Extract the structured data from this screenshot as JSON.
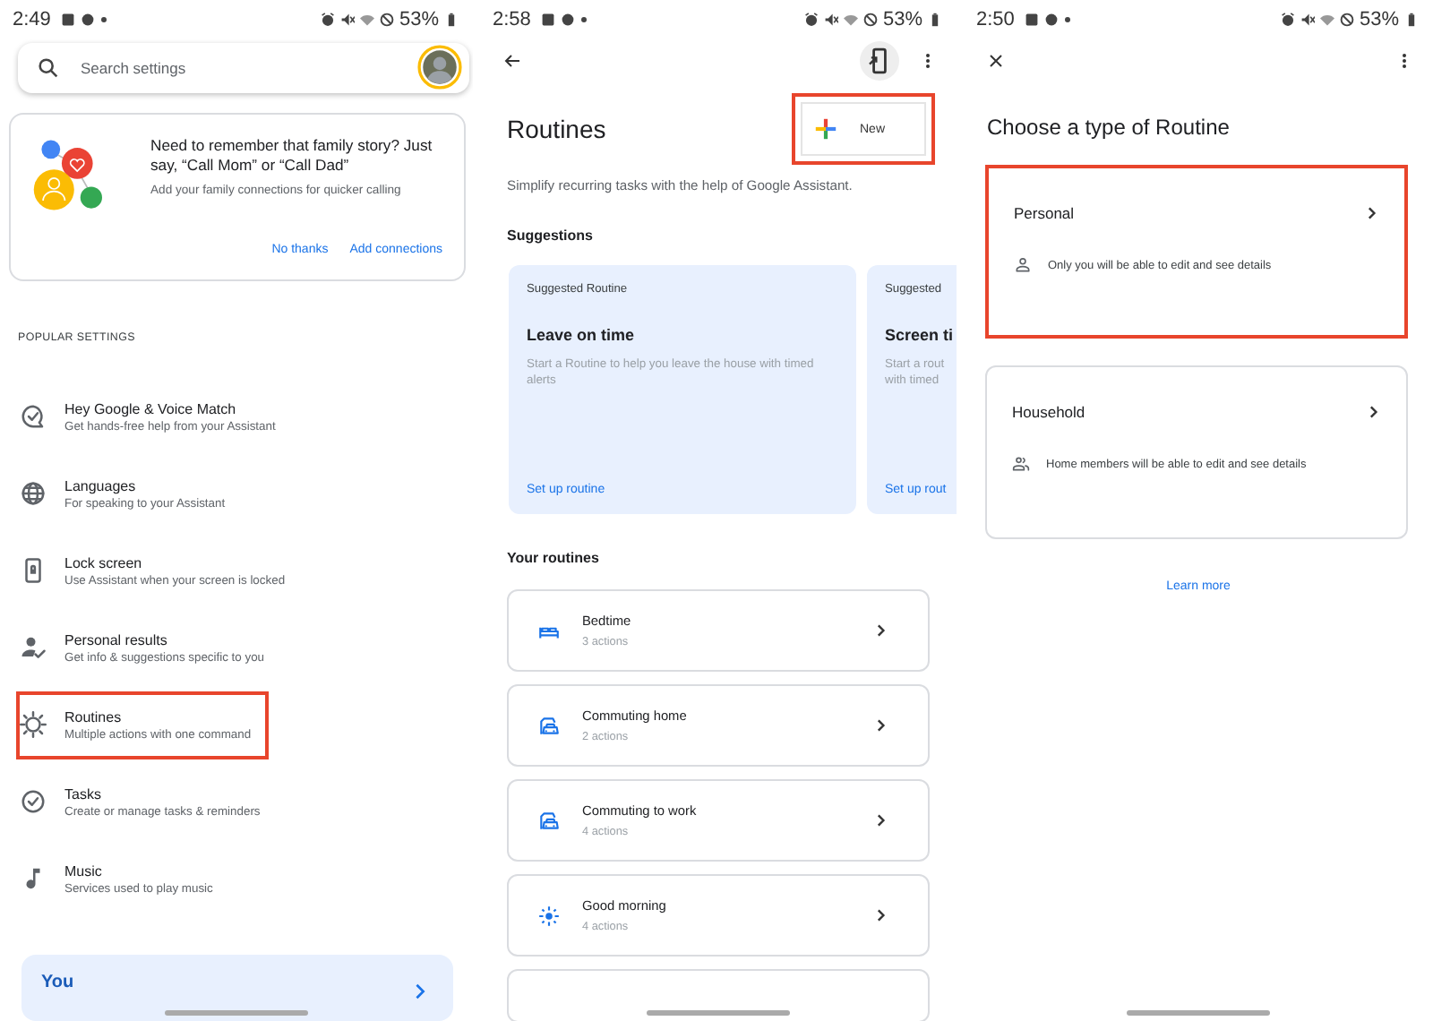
{
  "screens": [
    {
      "kind": "settings",
      "time": "2:49",
      "battery": "53%",
      "search": {
        "placeholder": "Search settings"
      },
      "promo": {
        "title": "Need to remember that family story? Just say, “Call Mom” or “Call Dad”",
        "subtitle": "Add your family connections for quicker calling",
        "actions": [
          "No thanks",
          "Add connections"
        ]
      },
      "section": "POPULAR SETTINGS",
      "items": [
        {
          "title": "Hey Google & Voice Match",
          "subtitle": "Get hands-free help from your Assistant",
          "highlighted": false
        },
        {
          "title": "Languages",
          "subtitle": "For speaking to your Assistant",
          "highlighted": false
        },
        {
          "title": "Lock screen",
          "subtitle": "Use Assistant when your screen is locked",
          "highlighted": false
        },
        {
          "title": "Personal results",
          "subtitle": "Get info & suggestions specific to you",
          "highlighted": false
        },
        {
          "title": "Routines",
          "subtitle": "Multiple actions with one command",
          "highlighted": true
        },
        {
          "title": "Tasks",
          "subtitle": "Create or manage tasks & reminders",
          "highlighted": false
        },
        {
          "title": "Music",
          "subtitle": "Services used to play music",
          "highlighted": false
        }
      ],
      "you_card": {
        "title": "You"
      }
    },
    {
      "kind": "routines",
      "time": "2:58",
      "battery": "53%",
      "title": "Routines",
      "new_button": {
        "label": "New",
        "highlighted": true
      },
      "description": "Simplify recurring tasks with the help of Google Assistant.",
      "suggestions_heading": "Suggestions",
      "suggestions": [
        {
          "tag": "Suggested Routine",
          "title": "Leave on time",
          "text": "Start a Routine to help you leave the house with timed alerts",
          "action": "Set up routine"
        },
        {
          "tag": "Suggested",
          "title": "Screen ti",
          "text": "Start a rout\nwith timed",
          "action": "Set up rout"
        }
      ],
      "routines_heading": "Your routines",
      "routines": [
        {
          "title": "Bedtime",
          "subtitle": "3 actions"
        },
        {
          "title": "Commuting home",
          "subtitle": "2 actions"
        },
        {
          "title": "Commuting to work",
          "subtitle": "4 actions"
        },
        {
          "title": "Good morning",
          "subtitle": "4 actions"
        }
      ]
    },
    {
      "kind": "type",
      "time": "2:50",
      "battery": "53%",
      "title": "Choose a type of Routine",
      "options": [
        {
          "title": "Personal",
          "description": "Only you will be able to edit and see details",
          "highlighted": true
        },
        {
          "title": "Household",
          "description": "Home members will be able to edit and see details",
          "highlighted": false
        }
      ],
      "link": "Learn more"
    }
  ]
}
